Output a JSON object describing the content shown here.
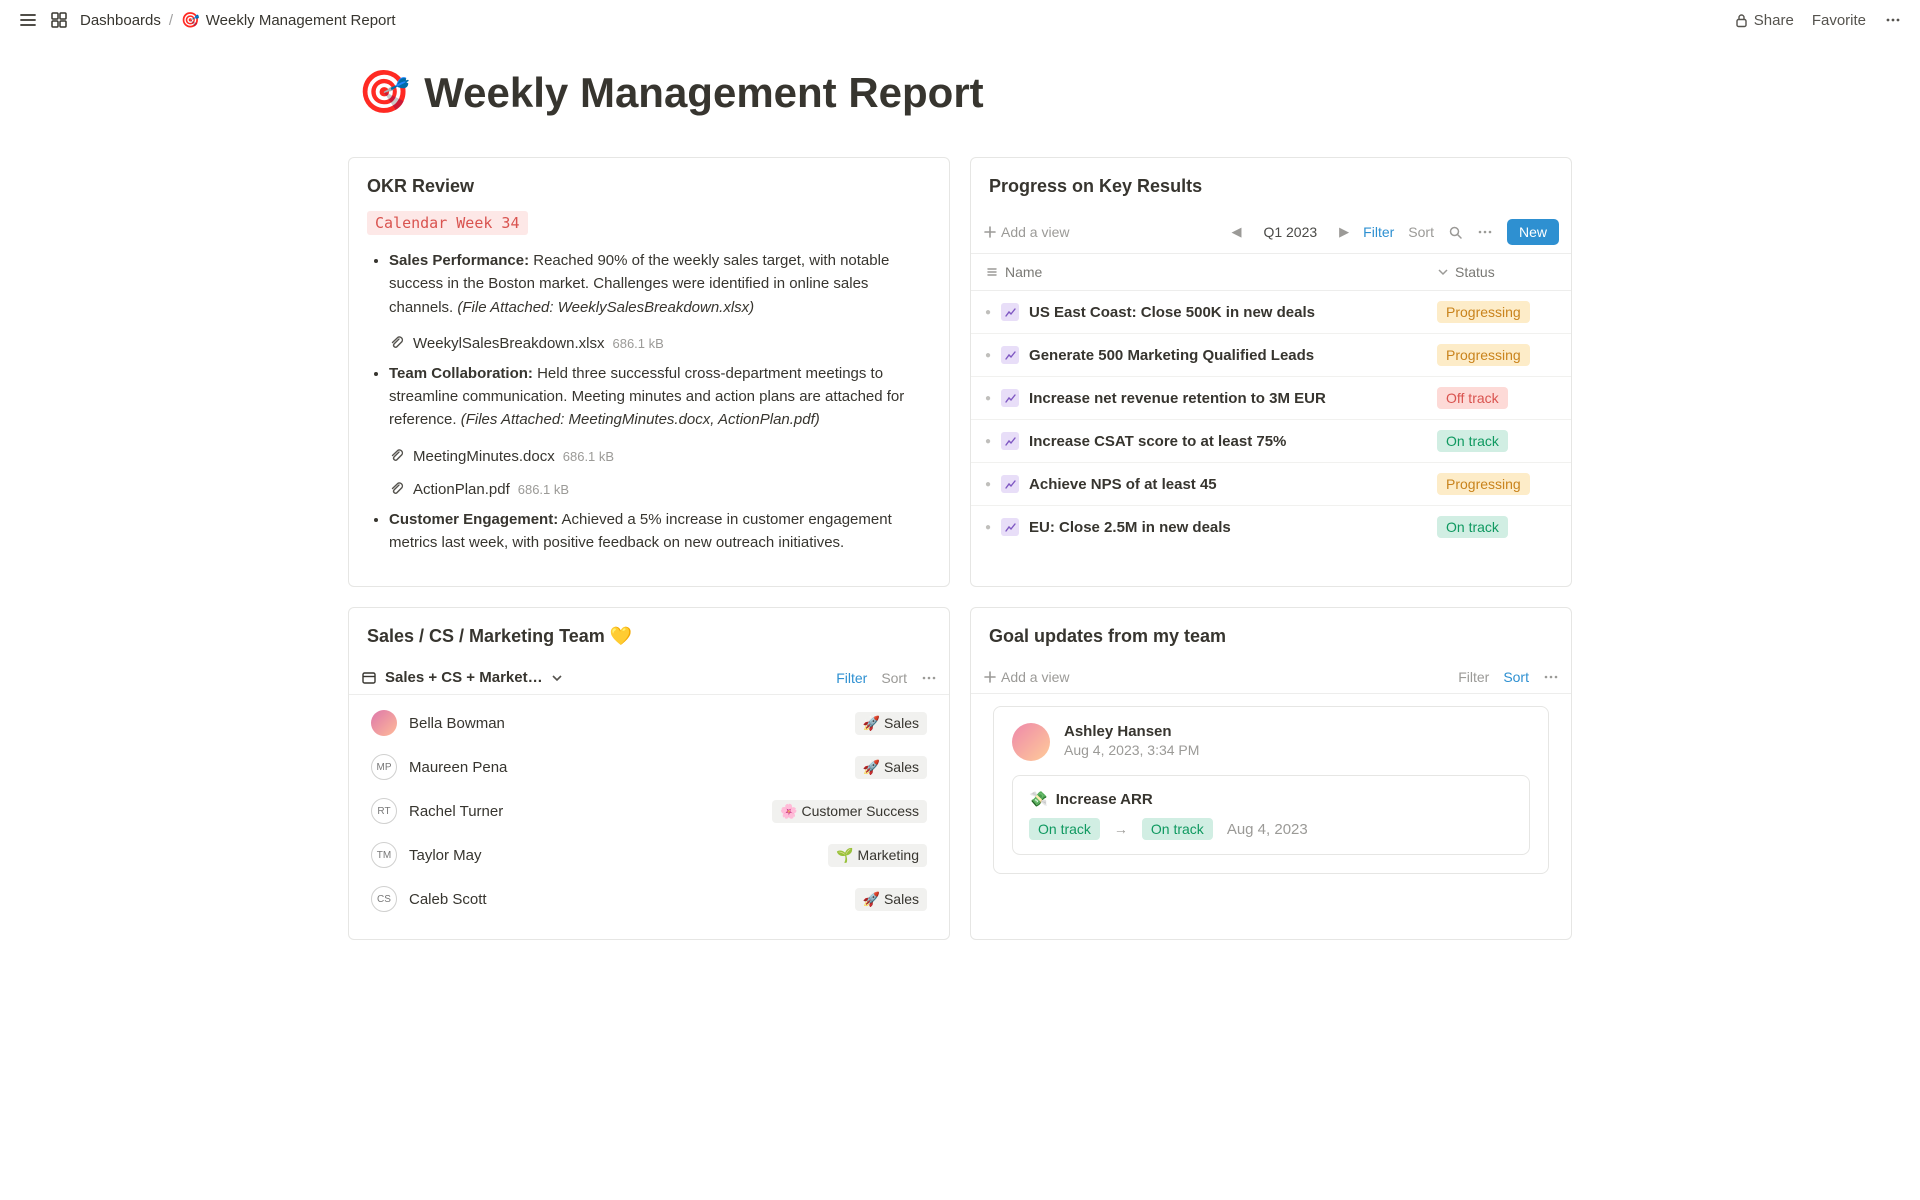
{
  "topbar": {
    "breadcrumb_root": "Dashboards",
    "breadcrumb_current": "Weekly Management Report",
    "breadcrumb_emoji": "🎯",
    "share": "Share",
    "favorite": "Favorite"
  },
  "page": {
    "emoji": "🎯",
    "title": "Weekly Management Report"
  },
  "okr": {
    "title": "OKR Review",
    "badge": "Calendar Week 34",
    "items": [
      {
        "heading": "Sales Performance:",
        "text": "Reached 90% of the weekly sales target, with notable success in the Boston market. Challenges were identified in online sales channels.",
        "note": "(File Attached: WeeklySalesBreakdown.xlsx)",
        "attachments": [
          {
            "name": "WeekylSalesBreakdown.xlsx",
            "size": "686.1 kB"
          }
        ]
      },
      {
        "heading": "Team Collaboration:",
        "text": "Held three successful cross-department meetings to streamline communication. Meeting minutes and action plans are attached for reference.",
        "note": "(Files Attached: MeetingMinutes.docx, ActionPlan.pdf)",
        "attachments": [
          {
            "name": "MeetingMinutes.docx",
            "size": "686.1 kB"
          },
          {
            "name": "ActionPlan.pdf",
            "size": "686.1 kB"
          }
        ]
      },
      {
        "heading": "Customer Engagement:",
        "text": "Achieved a 5% increase in customer engagement metrics last week, with positive feedback on new outreach initiatives.",
        "note": "",
        "attachments": []
      }
    ]
  },
  "kr": {
    "title": "Progress on Key Results",
    "add_view": "Add a view",
    "period": "Q1 2023",
    "filter": "Filter",
    "sort": "Sort",
    "new_btn": "New",
    "col_name": "Name",
    "col_status": "Status",
    "rows": [
      {
        "name": "US East Coast: Close 500K in new deals",
        "status": "Progressing"
      },
      {
        "name": "Generate 500 Marketing Qualified Leads",
        "status": "Progressing"
      },
      {
        "name": "Increase net revenue retention to 3M EUR",
        "status": "Off track"
      },
      {
        "name": "Increase CSAT score to at least 75%",
        "status": "On track"
      },
      {
        "name": "Achieve NPS of at least 45",
        "status": "Progressing"
      },
      {
        "name": "EU: Close 2.5M in new deals",
        "status": "On track"
      }
    ]
  },
  "team": {
    "title": "Sales / CS / Marketing Team 💛",
    "view_name": "Sales + CS + Market…",
    "filter": "Filter",
    "sort": "Sort",
    "members": [
      {
        "name": "Bella Bowman",
        "initials": "",
        "img": true,
        "tag_emoji": "🚀",
        "tag": "Sales"
      },
      {
        "name": "Maureen Pena",
        "initials": "MP",
        "img": false,
        "tag_emoji": "🚀",
        "tag": "Sales"
      },
      {
        "name": "Rachel Turner",
        "initials": "RT",
        "img": false,
        "tag_emoji": "🌸",
        "tag": "Customer Success"
      },
      {
        "name": "Taylor May",
        "initials": "TM",
        "img": false,
        "tag_emoji": "🌱",
        "tag": "Marketing"
      },
      {
        "name": "Caleb Scott",
        "initials": "CS",
        "img": false,
        "tag_emoji": "🚀",
        "tag": "Sales"
      }
    ]
  },
  "updates": {
    "title": "Goal updates from my team",
    "add_view": "Add a view",
    "filter": "Filter",
    "sort": "Sort",
    "entry": {
      "author": "Ashley Hansen",
      "timestamp": "Aug 4, 2023, 3:34 PM",
      "goal_emoji": "💸",
      "goal": "Increase ARR",
      "status_from": "On track",
      "status_to": "On track",
      "date": "Aug 4, 2023"
    }
  }
}
